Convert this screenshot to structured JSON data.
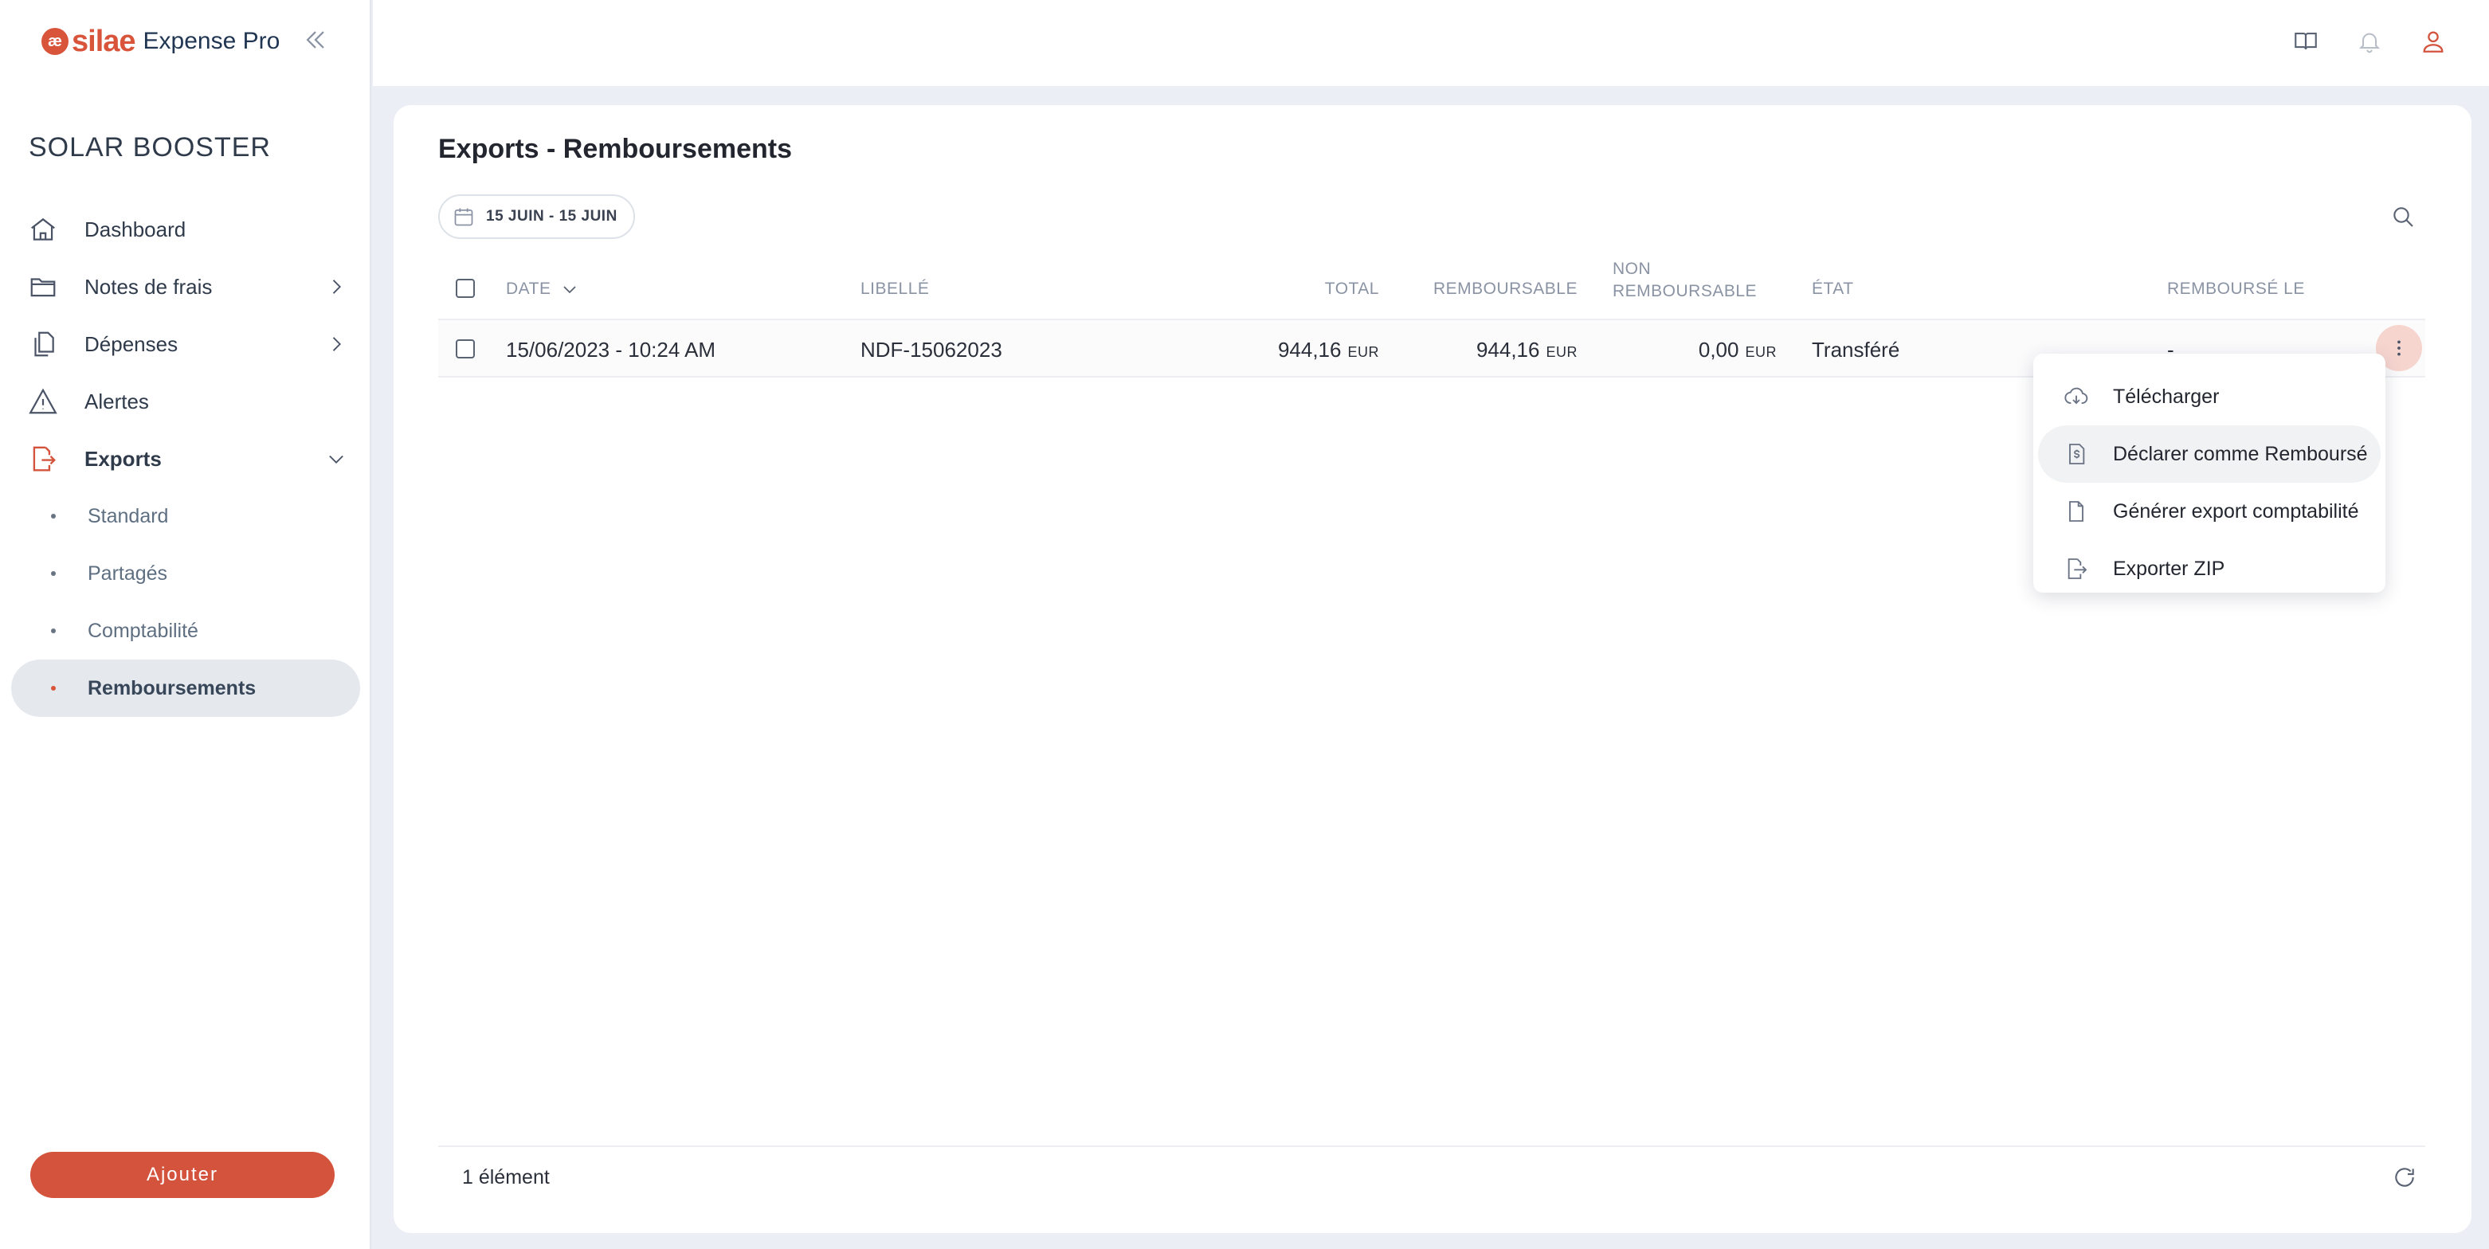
{
  "app": {
    "logo_mark": "æ",
    "brand": "silae",
    "product": "Expense Pro",
    "accent_color": "#d4533c"
  },
  "sidebar": {
    "company": "SOLAR BOOSTER",
    "items": [
      {
        "label": "Dashboard",
        "icon": "home-icon"
      },
      {
        "label": "Notes de frais",
        "icon": "folder-icon",
        "has_chevron": true
      },
      {
        "label": "Dépenses",
        "icon": "documents-icon",
        "has_chevron": true
      },
      {
        "label": "Alertes",
        "icon": "warning-icon"
      },
      {
        "label": "Exports",
        "icon": "export-icon",
        "expanded": true
      }
    ],
    "sub_items": [
      {
        "label": "Standard"
      },
      {
        "label": "Partagés"
      },
      {
        "label": "Comptabilité"
      },
      {
        "label": "Remboursements",
        "selected": true
      }
    ],
    "add_label": "Ajouter"
  },
  "topbar": {
    "icons": [
      "book-icon",
      "bell-icon",
      "user-icon"
    ]
  },
  "main": {
    "title": "Exports - Remboursements",
    "date_filter": "15 JUIN  -  15 JUIN",
    "columns": {
      "date": "DATE",
      "libelle": "LIBELLÉ",
      "total": "TOTAL",
      "remboursable": "REMBOURSABLE",
      "non_remboursable_1": "NON",
      "non_remboursable_2": "REMBOURSABLE",
      "etat": "ÉTAT",
      "rembourse_le": "REMBOURSÉ LE"
    },
    "rows": [
      {
        "date": "15/06/2023 - 10:24 AM",
        "libelle": "NDF-15062023",
        "total": "944,16",
        "total_cur": "EUR",
        "remboursable": "944,16",
        "remboursable_cur": "EUR",
        "non_remboursable": "0,00",
        "non_remboursable_cur": "EUR",
        "etat": "Transféré",
        "rembourse_le": "-"
      }
    ],
    "row_menu": [
      {
        "label": "Télécharger",
        "icon": "cloud-download-icon"
      },
      {
        "label": "Déclarer comme Remboursé",
        "icon": "invoice-dollar-icon"
      },
      {
        "label": "Générer export comptabilité",
        "icon": "file-icon"
      },
      {
        "label": "Exporter ZIP",
        "icon": "file-export-icon"
      }
    ],
    "footer_count": "1 élément"
  }
}
